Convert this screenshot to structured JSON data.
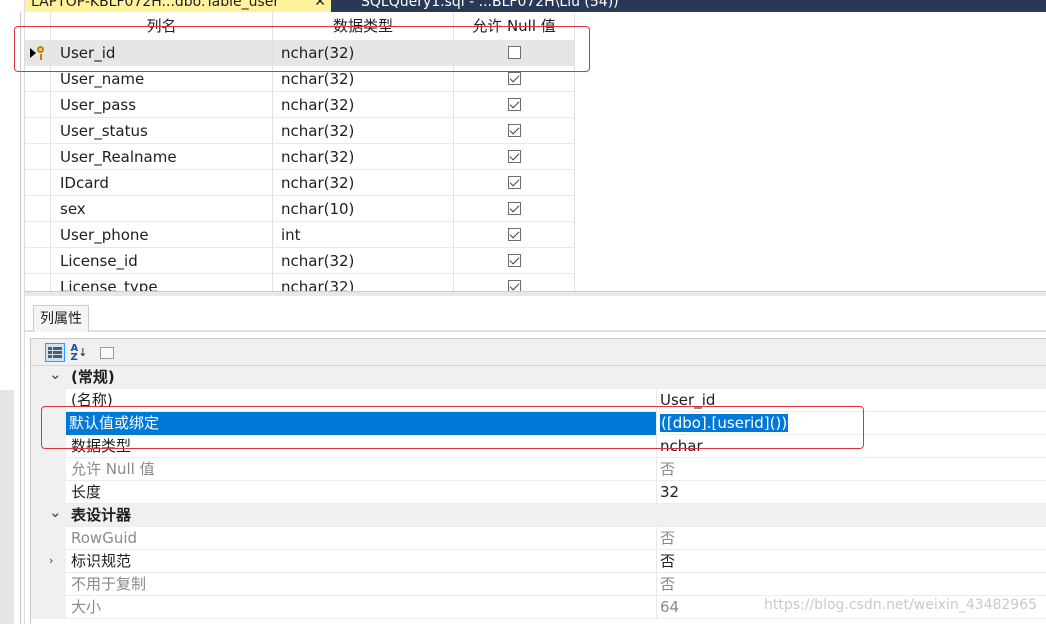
{
  "tabs": {
    "active_label": "LAPTOP-KBLF072H...dbo.Table_user",
    "close_glyph": "✕",
    "inactive_label": "SQLQuery1.sql - ...BLF072H\\Liu (54))"
  },
  "grid": {
    "headers": {
      "name": "列名",
      "type": "数据类型",
      "nullable": "允许 Null 值"
    },
    "rows": [
      {
        "name": "User_id",
        "type": "nchar(32)",
        "allow_null": false,
        "primary_key": true
      },
      {
        "name": "User_name",
        "type": "nchar(32)",
        "allow_null": true
      },
      {
        "name": "User_pass",
        "type": "nchar(32)",
        "allow_null": true
      },
      {
        "name": "User_status",
        "type": "nchar(32)",
        "allow_null": true
      },
      {
        "name": "User_Realname",
        "type": "nchar(32)",
        "allow_null": true
      },
      {
        "name": "IDcard",
        "type": "nchar(32)",
        "allow_null": true
      },
      {
        "name": "sex",
        "type": "nchar(10)",
        "allow_null": true
      },
      {
        "name": "User_phone",
        "type": "int",
        "allow_null": true
      },
      {
        "name": "License_id",
        "type": "nchar(32)",
        "allow_null": true
      },
      {
        "name": "License_type",
        "type": "nchar(32)",
        "allow_null": true
      }
    ]
  },
  "properties": {
    "tab_label": "列属性",
    "rows": [
      {
        "kind": "category",
        "name": "(常规)",
        "expanded": true
      },
      {
        "kind": "prop",
        "name": "(名称)",
        "value": "User_id"
      },
      {
        "kind": "prop",
        "name": "默认值或绑定",
        "value": "([dbo].[userid]())",
        "selected": true
      },
      {
        "kind": "prop",
        "name": "数据类型",
        "value": "nchar"
      },
      {
        "kind": "prop",
        "name": "允许 Null 值",
        "value": "否",
        "dim": true
      },
      {
        "kind": "prop",
        "name": "长度",
        "value": "32"
      },
      {
        "kind": "category",
        "name": "表设计器",
        "expanded": true
      },
      {
        "kind": "prop",
        "name": "RowGuid",
        "value": "否",
        "dim": true
      },
      {
        "kind": "prop",
        "name": "标识规范",
        "value": "否",
        "expandable": true
      },
      {
        "kind": "prop",
        "name": "不用于复制",
        "value": "否",
        "dim": true
      },
      {
        "kind": "prop",
        "name": "大小",
        "value": "64",
        "dim": true
      }
    ]
  },
  "watermark": "https://blog.csdn.net/weixin_43482965",
  "colors": {
    "selection": "#0078d7",
    "annotation": "#e0323c",
    "tabstrip": "#293955",
    "active_tab": "#fff29d"
  }
}
